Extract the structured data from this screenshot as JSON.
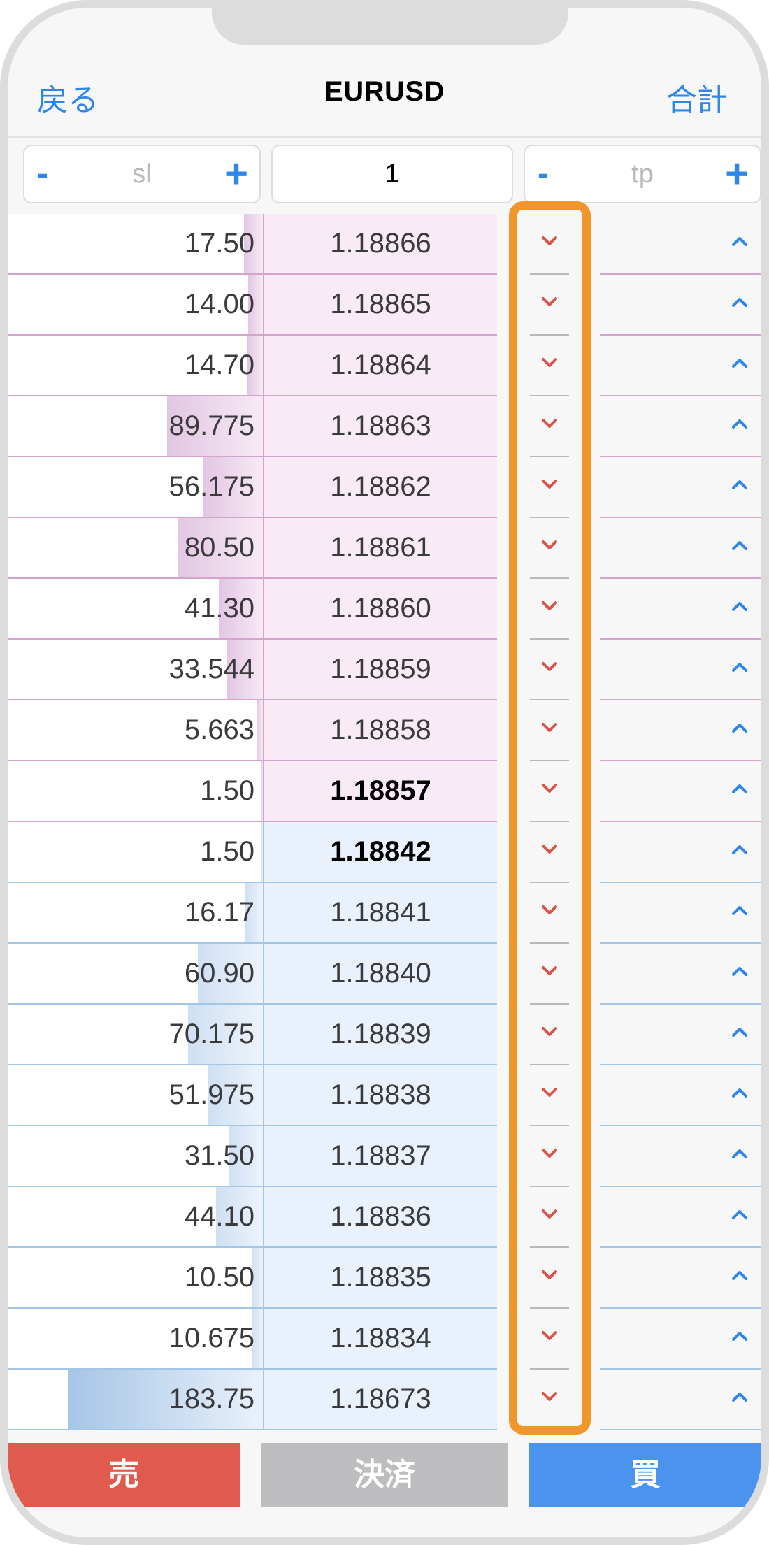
{
  "header": {
    "back_label": "戻る",
    "title": "EURUSD",
    "total_label": "合計"
  },
  "controls": {
    "sl": {
      "minus": "-",
      "placeholder": "sl",
      "plus": "+"
    },
    "quantity": "1",
    "tp": {
      "minus": "-",
      "placeholder": "tp",
      "plus": "+"
    }
  },
  "book": {
    "rows": [
      {
        "side": "ask",
        "volume": "17.50",
        "price": "1.18866"
      },
      {
        "side": "ask",
        "volume": "14.00",
        "price": "1.18865"
      },
      {
        "side": "ask",
        "volume": "14.70",
        "price": "1.18864"
      },
      {
        "side": "ask",
        "volume": "89.775",
        "price": "1.18863"
      },
      {
        "side": "ask",
        "volume": "56.175",
        "price": "1.18862"
      },
      {
        "side": "ask",
        "volume": "80.50",
        "price": "1.18861"
      },
      {
        "side": "ask",
        "volume": "41.30",
        "price": "1.18860"
      },
      {
        "side": "ask",
        "volume": "33.544",
        "price": "1.18859"
      },
      {
        "side": "ask",
        "volume": "5.663",
        "price": "1.18858"
      },
      {
        "side": "ask",
        "volume": "1.50",
        "price": "1.18857",
        "best": true
      },
      {
        "side": "bid",
        "volume": "1.50",
        "price": "1.18842",
        "best": true
      },
      {
        "side": "bid",
        "volume": "16.17",
        "price": "1.18841"
      },
      {
        "side": "bid",
        "volume": "60.90",
        "price": "1.18840"
      },
      {
        "side": "bid",
        "volume": "70.175",
        "price": "1.18839"
      },
      {
        "side": "bid",
        "volume": "51.975",
        "price": "1.18838"
      },
      {
        "side": "bid",
        "volume": "31.50",
        "price": "1.18837"
      },
      {
        "side": "bid",
        "volume": "44.10",
        "price": "1.18836"
      },
      {
        "side": "bid",
        "volume": "10.50",
        "price": "1.18835"
      },
      {
        "side": "bid",
        "volume": "10.675",
        "price": "1.18834"
      },
      {
        "side": "bid",
        "volume": "183.75",
        "price": "1.18673"
      }
    ],
    "sell_icon": "chevron-down-icon",
    "buy_icon": "chevron-up-icon",
    "sell_icon_color": "#d9534a",
    "buy_icon_color": "#2e86e8"
  },
  "highlight": {
    "color": "#f0962b"
  },
  "actions": {
    "sell_label": "売",
    "close_label": "決済",
    "buy_label": "買"
  }
}
